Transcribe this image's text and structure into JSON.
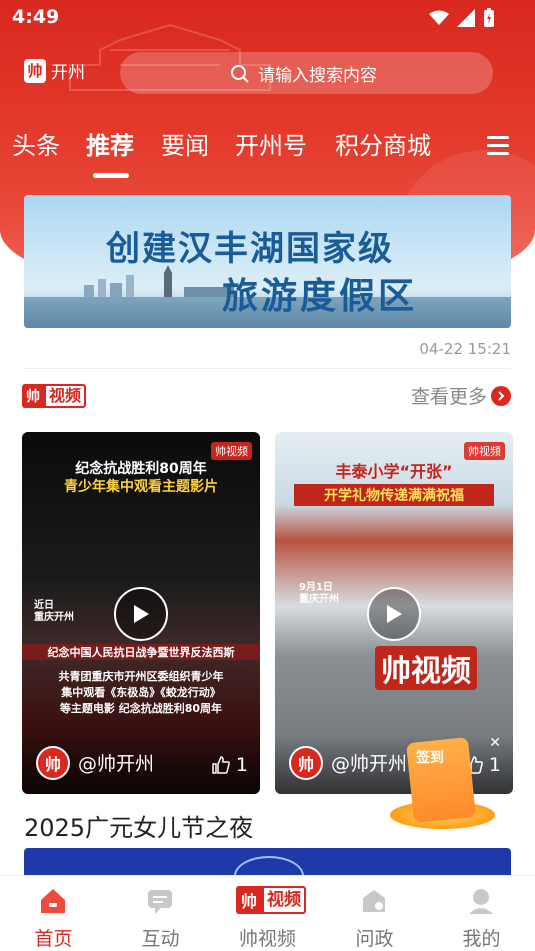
{
  "status": {
    "time": "4:49"
  },
  "header": {
    "brand_mark": "帅",
    "brand_name": "开州",
    "search_placeholder": "请输入搜索内容"
  },
  "tabs": [
    {
      "label": "头条"
    },
    {
      "label": "推荐",
      "active": true
    },
    {
      "label": "要闻"
    },
    {
      "label": "开州号"
    },
    {
      "label": "积分商城"
    }
  ],
  "banner": {
    "line1": "创建汉丰湖国家级",
    "line2": "旅游度假区",
    "timestamp": "04-22 15:21"
  },
  "video_section": {
    "logo_mark": "帅",
    "logo_text": "视频",
    "more_label": "查看更多",
    "cards": [
      {
        "tag": "帅视频",
        "title_line1": "纪念抗战胜利80周年",
        "title_line2": "青少年集中观看主题影片",
        "caption": "近日\n重庆开州",
        "banner_text": "纪念中国人民抗日战争暨世界反法西斯",
        "desc_line1": "共青团重庆市开州区委组织青少年",
        "desc_line2": "集中观看《东极岛》《蛟龙行动》",
        "desc_line3": "等主题电影 纪念抗战胜利80周年",
        "avatar": "帅",
        "author": "@帅开州",
        "likes": "1"
      },
      {
        "tag": "帅视频",
        "title_line1": "丰泰小学“开张”",
        "title_line2": "开学礼物传递满满祝福",
        "caption": "9月1日\n重庆开州",
        "watermark": "帅视频",
        "avatar": "帅",
        "author": "@帅开州",
        "likes": "1"
      }
    ],
    "next_title": "2025广元女儿节之夜"
  },
  "signin": {
    "label": "签到"
  },
  "bottom_nav": [
    {
      "label": "首页",
      "icon": "home-icon",
      "active": true
    },
    {
      "label": "互动",
      "icon": "chat-icon"
    },
    {
      "label": "帅视频",
      "icon": "video-logo"
    },
    {
      "label": "问政",
      "icon": "gov-icon"
    },
    {
      "label": "我的",
      "icon": "profile-icon"
    }
  ],
  "colors": {
    "brand_red": "#d9281f",
    "banner_blue": "#1a5c97"
  }
}
